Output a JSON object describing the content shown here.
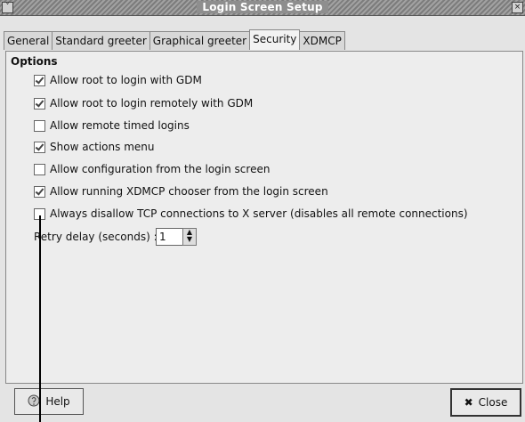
{
  "window": {
    "title": "Login Screen Setup"
  },
  "tabs": [
    {
      "label": "General"
    },
    {
      "label": "Standard greeter"
    },
    {
      "label": "Graphical greeter"
    },
    {
      "label": "Security"
    },
    {
      "label": "XDMCP"
    }
  ],
  "options_section": {
    "title": "Options",
    "items": [
      {
        "label": "Allow root to login with GDM",
        "checked": true
      },
      {
        "label": "Allow root to login remotely with GDM",
        "checked": true
      },
      {
        "label": "Allow remote timed logins",
        "checked": false
      },
      {
        "label": "Show actions menu",
        "checked": true
      },
      {
        "label": "Allow configuration from the login screen",
        "checked": false
      },
      {
        "label": "Allow running XDMCP chooser from the login screen",
        "checked": true
      },
      {
        "label": "Always disallow TCP connections to X server (disables all remote connections)",
        "checked": false
      }
    ],
    "retry": {
      "label": "Retry delay (seconds) :",
      "value": "1"
    }
  },
  "buttons": {
    "help_label": "Help",
    "close_label": "Close"
  }
}
